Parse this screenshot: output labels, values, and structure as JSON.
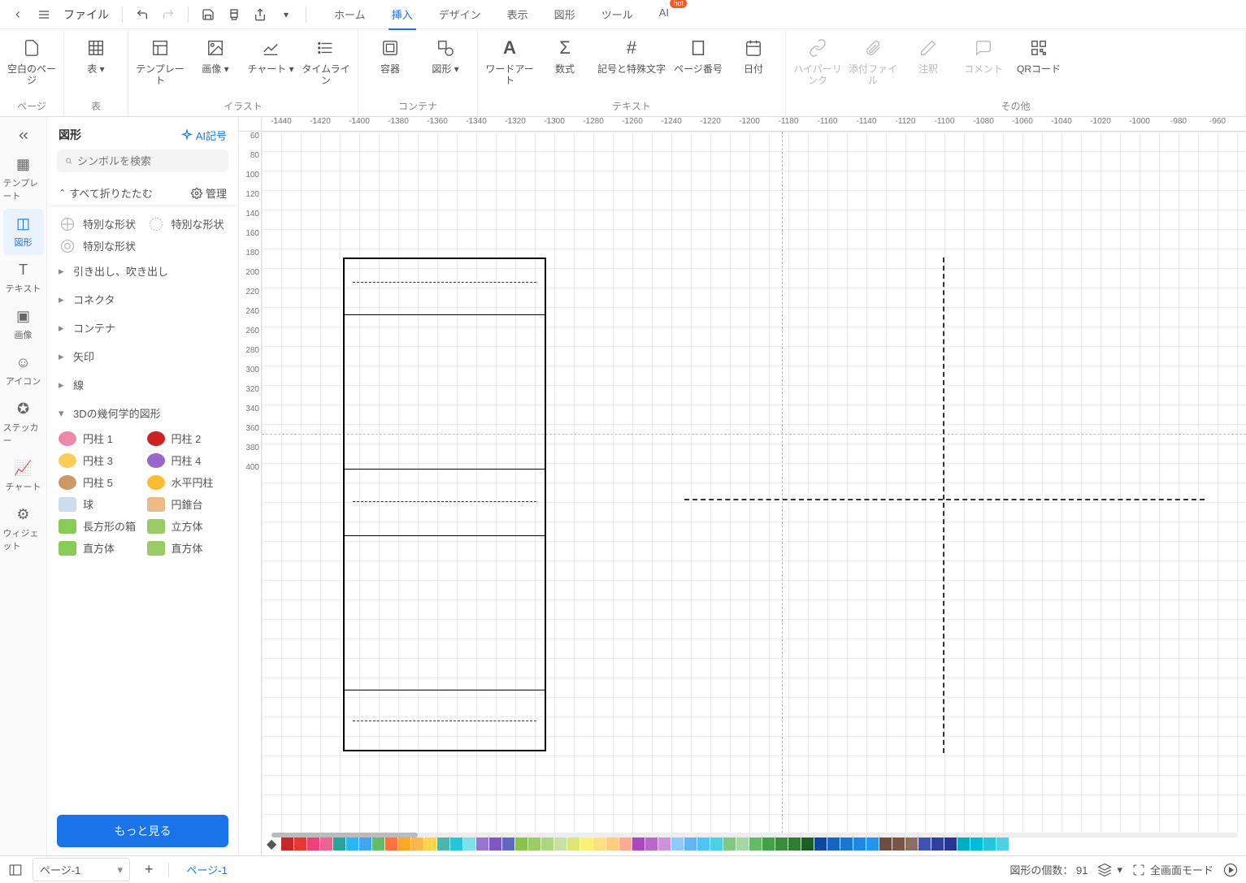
{
  "topbar": {
    "file": "ファイル",
    "tabs": [
      "ホーム",
      "挿入",
      "デザイン",
      "表示",
      "図形",
      "ツール",
      "AI"
    ],
    "active_tab": 1,
    "hot": "hot"
  },
  "ribbon": {
    "groups": [
      {
        "label": "ページ",
        "items": [
          {
            "k": "blank",
            "label": "空白のページ"
          }
        ]
      },
      {
        "label": "表",
        "items": [
          {
            "k": "table",
            "label": "表"
          }
        ]
      },
      {
        "label": "イラスト",
        "items": [
          {
            "k": "template",
            "label": "テンプレート"
          },
          {
            "k": "image",
            "label": "画像"
          },
          {
            "k": "chart",
            "label": "チャート"
          },
          {
            "k": "timeline",
            "label": "タイムライン"
          }
        ]
      },
      {
        "label": "コンテナ",
        "items": [
          {
            "k": "container",
            "label": "容器"
          },
          {
            "k": "shape",
            "label": "図形"
          }
        ]
      },
      {
        "label": "テキスト",
        "items": [
          {
            "k": "wordart",
            "label": "ワードアート"
          },
          {
            "k": "formula",
            "label": "数式"
          },
          {
            "k": "symbols",
            "label": "記号と特殊文字"
          },
          {
            "k": "pagenum",
            "label": "ページ番号"
          },
          {
            "k": "date",
            "label": "日付"
          }
        ]
      },
      {
        "label": "その他",
        "items": [
          {
            "k": "hyperlink",
            "label": "ハイパーリンク",
            "disabled": true
          },
          {
            "k": "attach",
            "label": "添付ファイル",
            "disabled": true
          },
          {
            "k": "comment",
            "label": "注釈",
            "disabled": true
          },
          {
            "k": "note",
            "label": "コメント",
            "disabled": true
          },
          {
            "k": "qr",
            "label": "QRコード"
          }
        ]
      }
    ]
  },
  "leftbar": {
    "items": [
      {
        "k": "template",
        "label": "テンプレート"
      },
      {
        "k": "shape",
        "label": "図形",
        "active": true
      },
      {
        "k": "text",
        "label": "テキスト"
      },
      {
        "k": "image",
        "label": "画像"
      },
      {
        "k": "icon",
        "label": "アイコン"
      },
      {
        "k": "sticker",
        "label": "ステッカー"
      },
      {
        "k": "chart",
        "label": "チャート"
      },
      {
        "k": "widget",
        "label": "ウィジェット"
      }
    ]
  },
  "panel": {
    "title": "図形",
    "ai_label": "AI記号",
    "search_placeholder": "シンボルを検索",
    "fold_all": "すべて折りたたむ",
    "manage": "管理",
    "special": "特別な形状",
    "categories": [
      "引き出し、吹き出し",
      "コネクタ",
      "コンテナ",
      "矢印",
      "線"
    ],
    "group3d": "3Dの幾何学的図形",
    "shapes3d": [
      [
        "円柱 1",
        "円柱 2"
      ],
      [
        "円柱 3",
        "円柱 4"
      ],
      [
        "円柱 5",
        "水平円柱"
      ],
      [
        "球",
        "円錐台"
      ],
      [
        "長方形の箱",
        "立方体"
      ],
      [
        "直方体",
        "直方体"
      ]
    ],
    "more": "もっと見る"
  },
  "ruler_h": [
    "-1440",
    "-1420",
    "-1400",
    "-1380",
    "-1360",
    "-1340",
    "-1320",
    "-1300",
    "-1280",
    "-1260",
    "-1240",
    "-1220",
    "-1200",
    "-1180",
    "-1160",
    "-1140",
    "-1120",
    "-1100",
    "-1080",
    "-1060",
    "-1040",
    "-1020",
    "-1000",
    "-980",
    "-960"
  ],
  "ruler_v": [
    "60",
    "80",
    "100",
    "120",
    "140",
    "160",
    "180",
    "200",
    "220",
    "240",
    "260",
    "280",
    "300",
    "320",
    "340",
    "360",
    "380",
    "400"
  ],
  "palette": [
    "#c62828",
    "#e53935",
    "#ec407a",
    "#f06292",
    "#26a69a",
    "#29b6f6",
    "#42a5f5",
    "#66bb6a",
    "#ff7043",
    "#ffa726",
    "#ffb74d",
    "#ffd54f",
    "#4db6ac",
    "#26c6da",
    "#80deea",
    "#9575cd",
    "#7e57c2",
    "#5c6bc0",
    "#8bc34a",
    "#9ccc65",
    "#aed581",
    "#c5e1a5",
    "#dce775",
    "#fff176",
    "#ffe082",
    "#ffcc80",
    "#ffab91",
    "#ab47bc",
    "#ba68c8",
    "#ce93d8",
    "#90caf9",
    "#64b5f6",
    "#4fc3f7",
    "#4dd0e1",
    "#81c784",
    "#a5d6a7",
    "#66bb6a",
    "#43a047",
    "#388e3c",
    "#2e7d32",
    "#1b5e20",
    "#0d47a1",
    "#1565c0",
    "#1976d2",
    "#1e88e5",
    "#2196f3",
    "#6d4c41",
    "#795548",
    "#8d6e63",
    "#3f51b5",
    "#303f9f",
    "#283593",
    "#00acc1",
    "#00bcd4",
    "#26c6da",
    "#4dd0e1"
  ],
  "status": {
    "page_sel": "ページ-1",
    "page_tab": "ページ-1",
    "shape_count_label": "図形の個数：",
    "shape_count": "91",
    "fullscreen": "全画面モード"
  }
}
